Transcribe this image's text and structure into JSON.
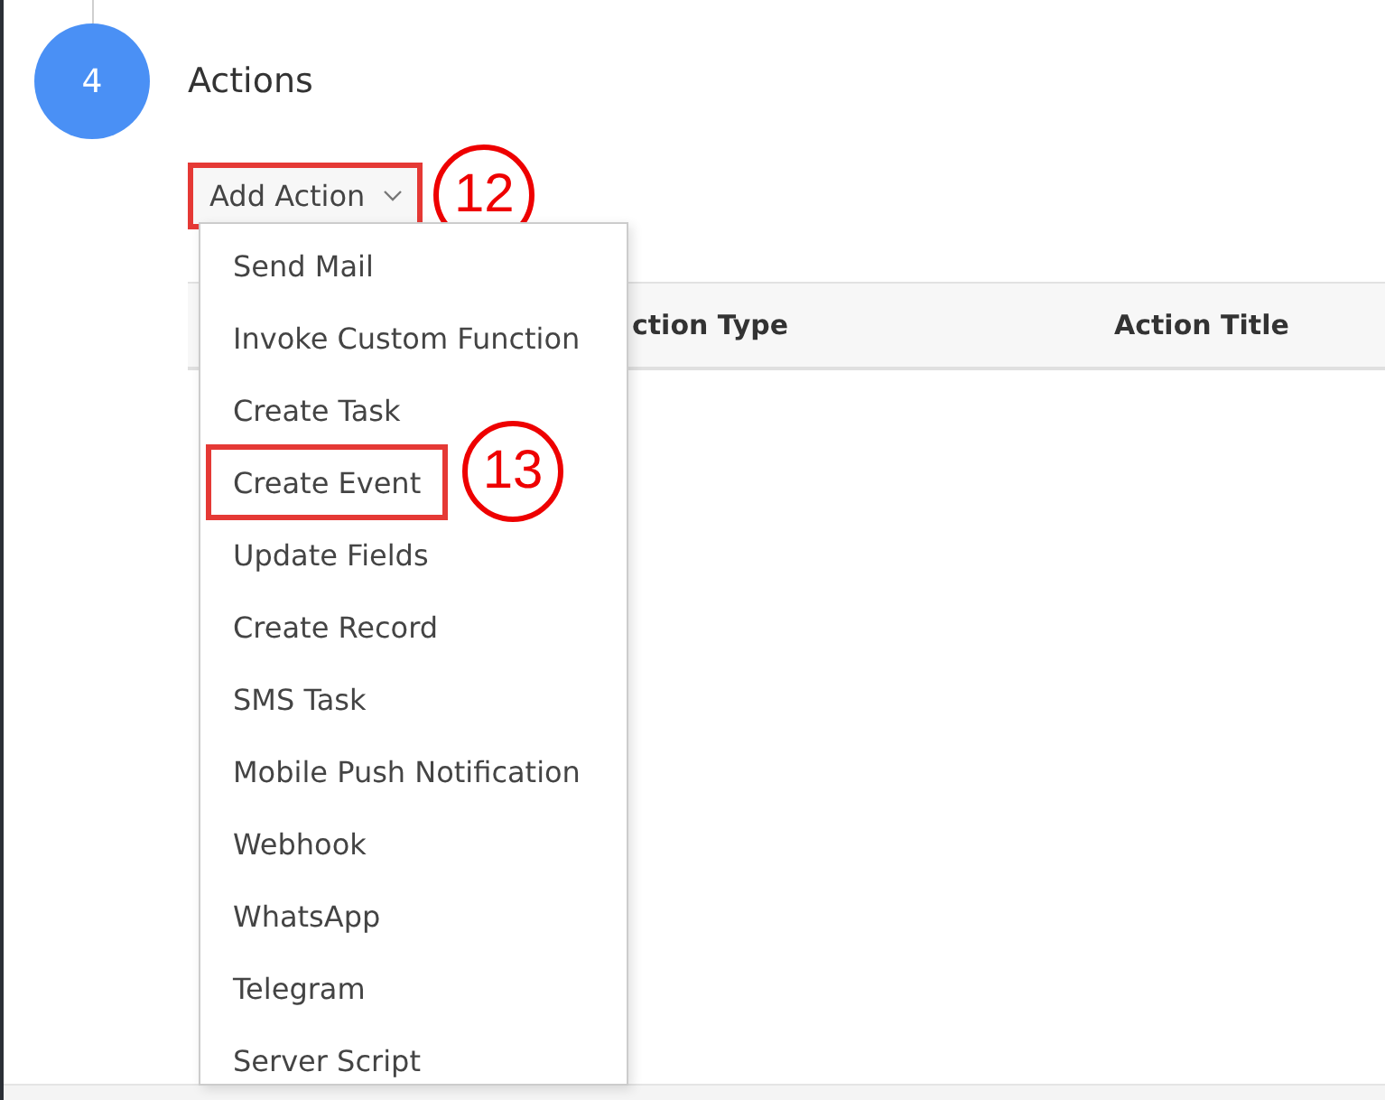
{
  "step": {
    "number": "4",
    "title": "Actions"
  },
  "add_action_button": {
    "label": "Add Action",
    "callout": "12",
    "annotated": true
  },
  "table": {
    "columns": [
      "ction Type",
      "Action Title"
    ]
  },
  "menu": {
    "items": [
      {
        "label": "Send Mail",
        "annotated": false
      },
      {
        "label": "Invoke Custom Function",
        "annotated": false
      },
      {
        "label": "Create Task",
        "annotated": false
      },
      {
        "label": "Create Event",
        "annotated": true,
        "callout": "13"
      },
      {
        "label": "Update Fields",
        "annotated": false
      },
      {
        "label": "Create Record",
        "annotated": false
      },
      {
        "label": "SMS Task",
        "annotated": false
      },
      {
        "label": "Mobile Push Notification",
        "annotated": false
      },
      {
        "label": "Webhook",
        "annotated": false
      },
      {
        "label": "WhatsApp",
        "annotated": false
      },
      {
        "label": "Telegram",
        "annotated": false
      },
      {
        "label": "Server Script",
        "annotated": false
      }
    ]
  }
}
